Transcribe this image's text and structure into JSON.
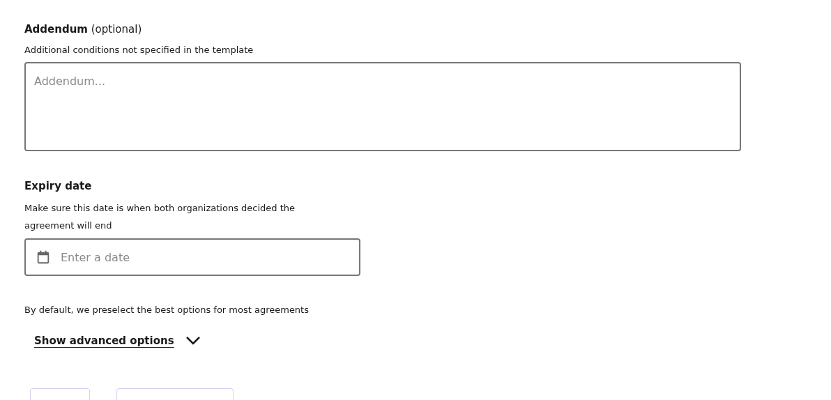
{
  "addendum": {
    "label": "**Addendum** (optional)",
    "description": "Additional conditions not specified in the template",
    "placeholder": "Addendum..."
  },
  "expiry": {
    "label": "Expiry date",
    "description_lines": [
      "Make sure this date is when both organizations decided the",
      "agreement will end"
    ],
    "placeholder": "Enter a date"
  },
  "defaults_note": "By default, we preselect the best options for most agreements",
  "advanced": {
    "label": "Show advanced options",
    "expanded": false
  }
}
